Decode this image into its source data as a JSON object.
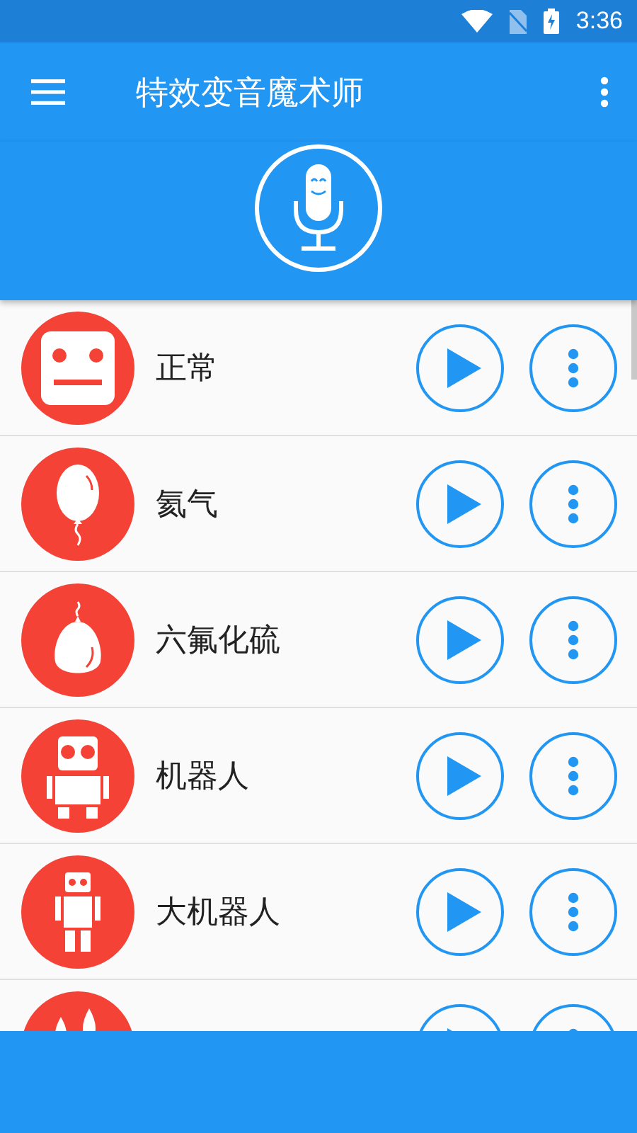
{
  "status_bar": {
    "time": "3:36"
  },
  "app_bar": {
    "title": "特效变音魔术师"
  },
  "effects": [
    {
      "kind": "face",
      "name": "正常"
    },
    {
      "kind": "balloon",
      "name": "氦气"
    },
    {
      "kind": "heavy",
      "name": "六氟化硫"
    },
    {
      "kind": "robot",
      "name": "机器人"
    },
    {
      "kind": "tall",
      "name": "大机器人"
    },
    {
      "kind": "drops"
    }
  ]
}
